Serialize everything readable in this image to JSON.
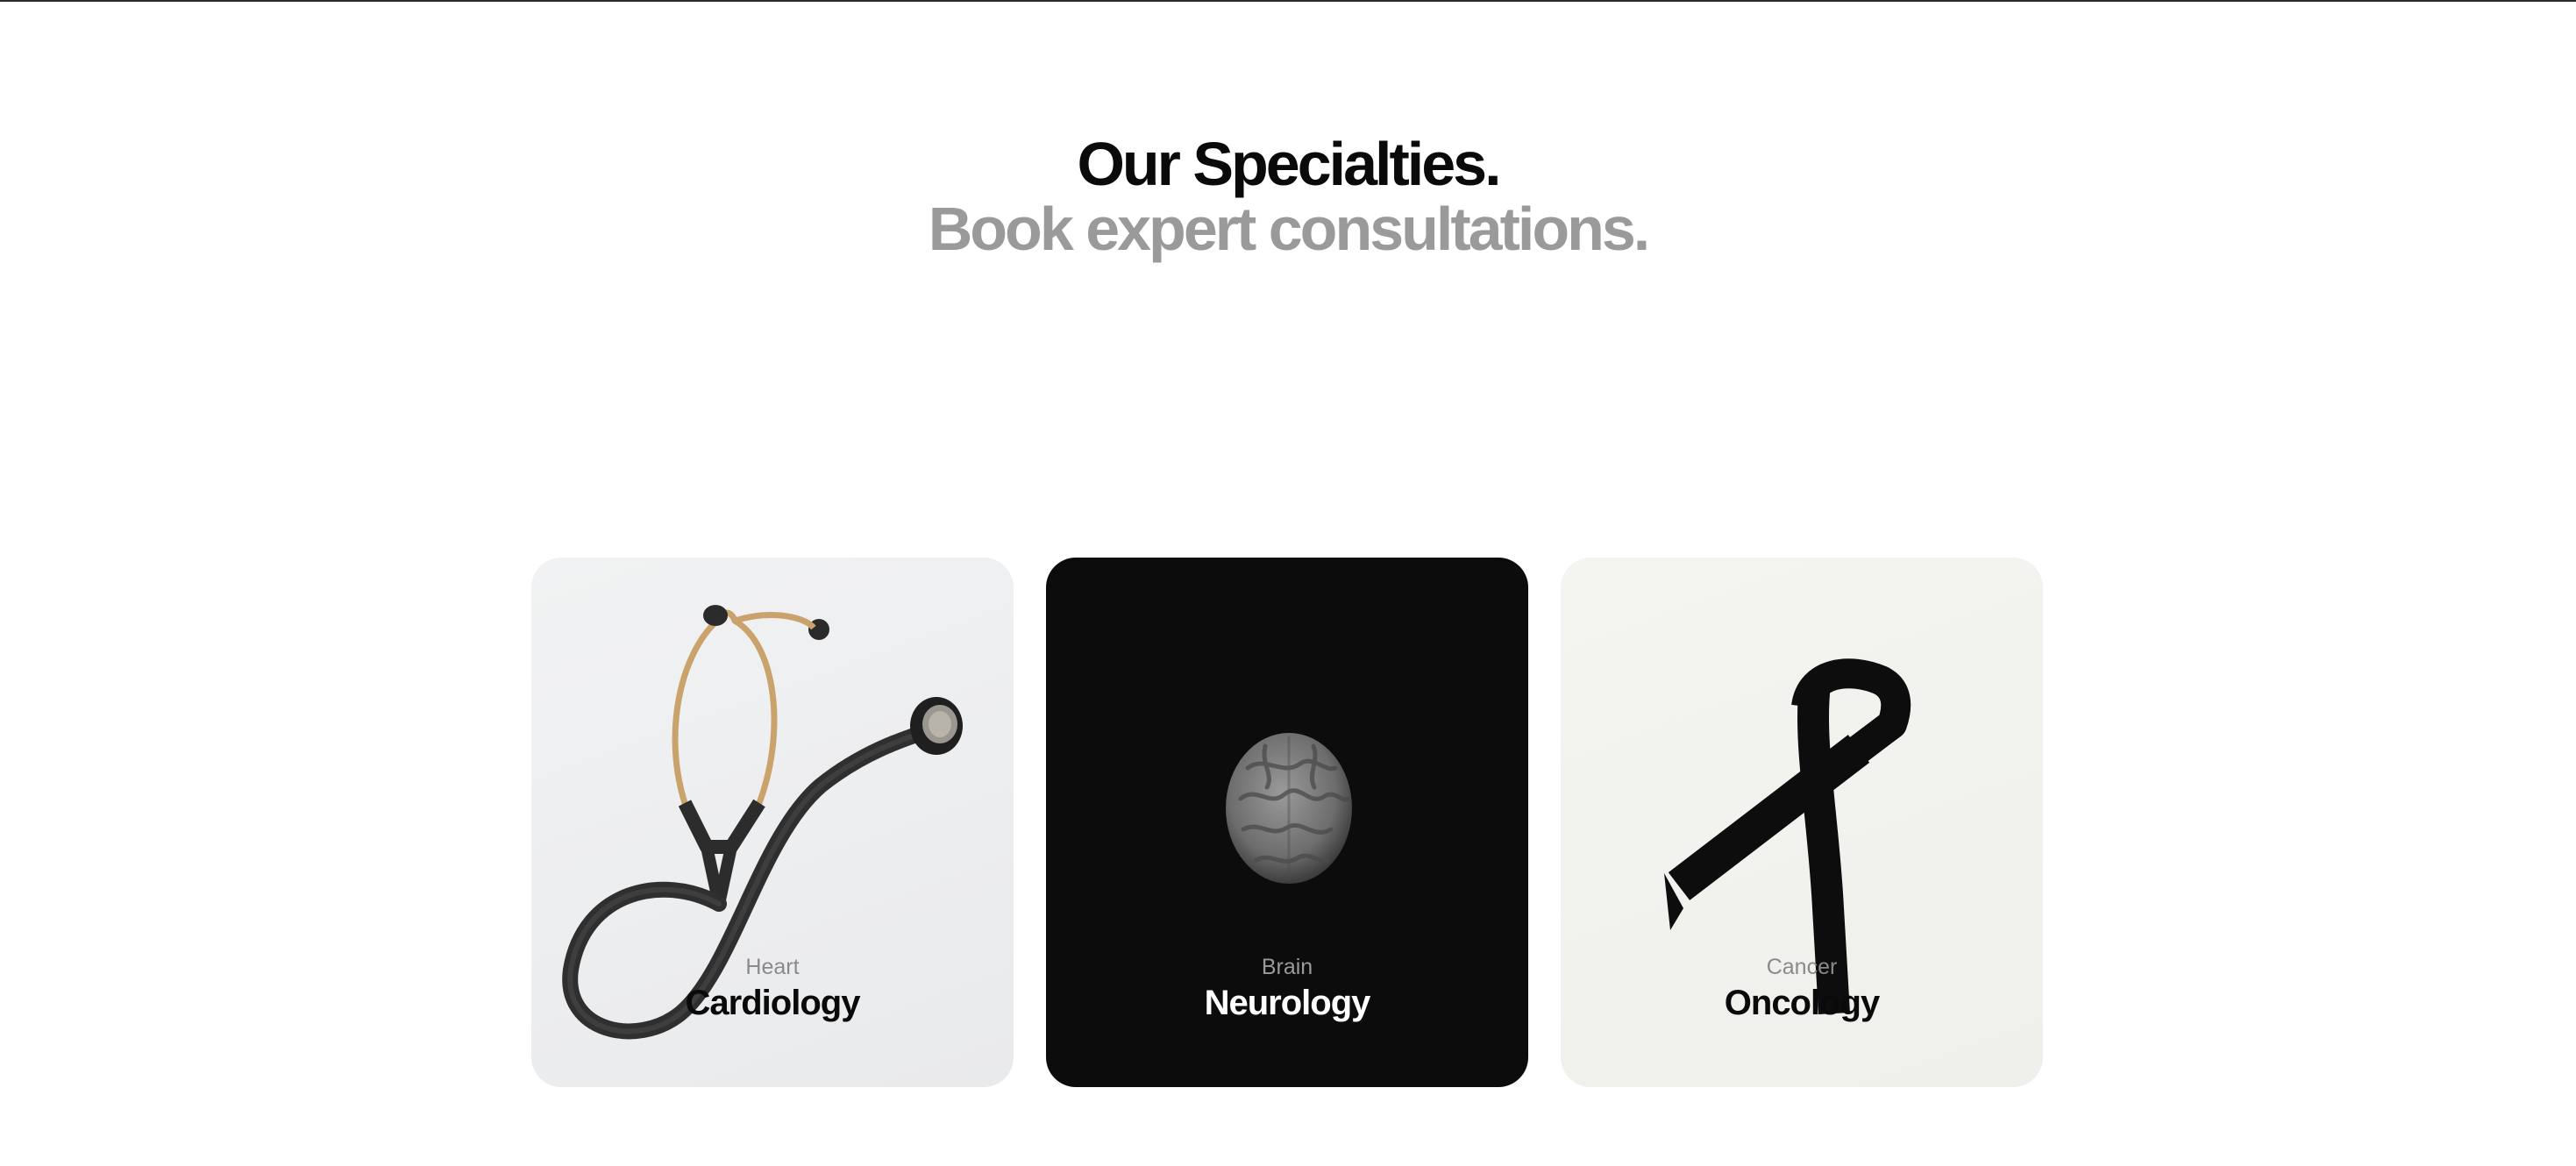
{
  "header": {
    "title": "Our Specialties.",
    "subtitle": "Book expert consultations."
  },
  "specialties": [
    {
      "category": "Heart",
      "name": "Cardiology",
      "icon": "stethoscope-icon"
    },
    {
      "category": "Brain",
      "name": "Neurology",
      "icon": "brain-icon"
    },
    {
      "category": "Cancer",
      "name": "Oncology",
      "icon": "awareness-ribbon-icon"
    }
  ],
  "colors": {
    "title": "#0a0a0a",
    "subtitle": "#9a9a9a",
    "card_dark": "#0c0c0c",
    "card_light": "#f1f2f3"
  }
}
